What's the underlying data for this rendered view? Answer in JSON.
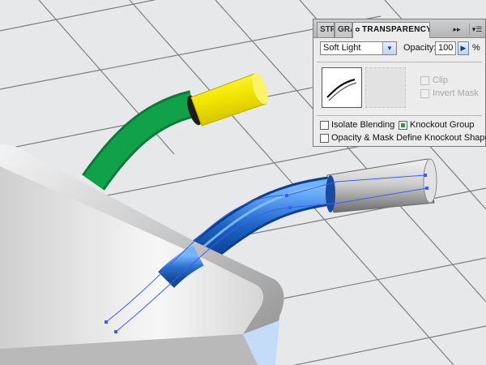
{
  "panel": {
    "tabs": [
      {
        "label": "STR"
      },
      {
        "label": "GRA"
      },
      {
        "label": "TRANSPARENCY",
        "grip": "≎"
      }
    ],
    "collapse_glyph": "▸▸",
    "menu_glyph": "▾☰",
    "blend_mode": "Soft Light",
    "dropdown_glyph": "▼",
    "opacity_label": "Opacity:",
    "opacity_value": "100",
    "stepper_glyph": "▶",
    "percent_sign": "%",
    "clip_label": "Clip",
    "invert_mask_label": "Invert Mask",
    "isolate_blending_label": "Isolate Blending",
    "knockout_group_label": "Knockout Group",
    "knockout_group_checked": true,
    "opacity_mask_label": "Opacity & Mask Define Knockout Shape"
  },
  "colors": {
    "background": "#e6e8ea",
    "grid_line": "#7e7e7e",
    "green_hose": "#12a14b",
    "yellow_nozzle": "#f5e800",
    "blue_hose": "#1f66c6",
    "path_selection": "#3a5cff",
    "sink_steel": "#c8c8c8"
  }
}
